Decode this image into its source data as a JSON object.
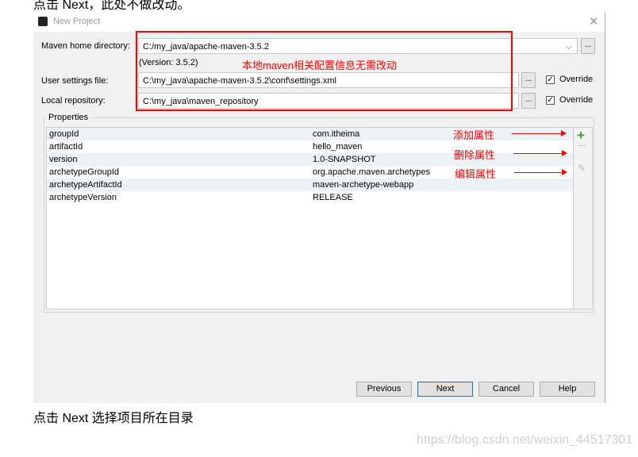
{
  "doc": {
    "top_text": "点击 Next，此处不做改动。",
    "bottom_text": "点击 Next 选择项目所在目录",
    "watermark": "https://blog.csdn.net/weixin_44517301"
  },
  "dialog": {
    "title": "New Project",
    "maven_home": {
      "label": "Maven home directory:",
      "value": "C:/my_java/apache-maven-3.5.2",
      "version": "(Version: 3.5.2)"
    },
    "user_settings": {
      "label": "User settings file:",
      "value": "C:\\my_java\\apache-maven-3.5.2\\conf\\settings.xml",
      "override": "Override",
      "override_checked": true
    },
    "local_repo": {
      "label": "Local repository:",
      "value": "C:\\my_java\\maven_repository",
      "override": "Override",
      "override_checked": true
    },
    "browse": "...",
    "properties": {
      "title": "Properties",
      "rows": [
        {
          "key": "groupId",
          "value": "com.itheima"
        },
        {
          "key": "artifactId",
          "value": "hello_maven"
        },
        {
          "key": "version",
          "value": "1.0-SNAPSHOT"
        },
        {
          "key": "archetypeGroupId",
          "value": "org.apache.maven.archetypes"
        },
        {
          "key": "archetypeArtifactId",
          "value": "maven-archetype-webapp"
        },
        {
          "key": "archetypeVersion",
          "value": "RELEASE"
        }
      ]
    },
    "buttons": {
      "previous": "Previous",
      "next": "Next",
      "cancel": "Cancel",
      "help": "Help"
    }
  },
  "annotations": {
    "config_note": "本地maven相关配置信息无需改动",
    "add": "添加属性",
    "remove": "删除属性",
    "edit": "编辑属性",
    "color": "#ff0000"
  }
}
